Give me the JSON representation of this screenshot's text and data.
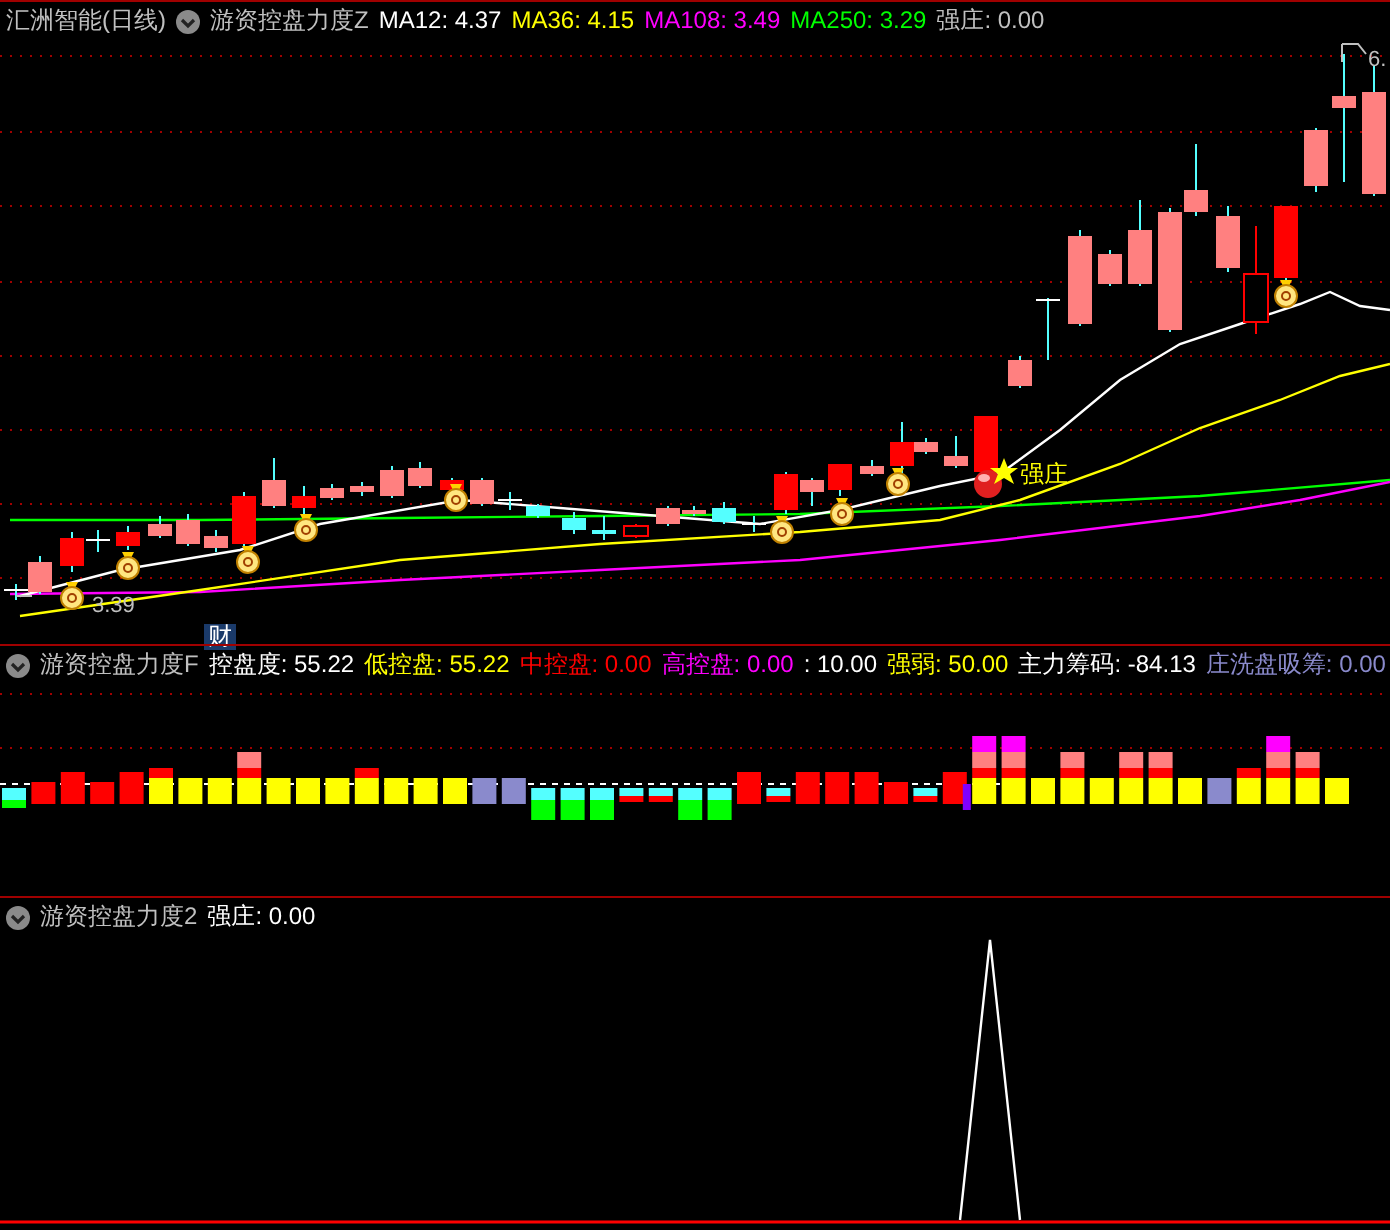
{
  "panels": [
    {
      "title": "汇洲智能(日线)",
      "indicator": "游资控盘力度Z",
      "legend": [
        {
          "text": "MA12: 4.37",
          "color": "#ffffff"
        },
        {
          "text": "MA36: 4.15",
          "color": "#ffff00"
        },
        {
          "text": "MA108: 3.49",
          "color": "#ff00ff"
        },
        {
          "text": "MA250: 3.29",
          "color": "#00ff00"
        },
        {
          "text": "强庄: 0.00",
          "color": "#c0c0c0"
        }
      ],
      "labels": {
        "high_price": "6.",
        "low_price": "3.39",
        "signal": "强庄",
        "badge": "财"
      }
    },
    {
      "indicator": "游资控盘力度F",
      "legend": [
        {
          "text": "控盘度: 55.22",
          "color": "#ffffff"
        },
        {
          "text": "低控盘: 55.22",
          "color": "#ffff00"
        },
        {
          "text": "中控盘: 0.00",
          "color": "#ff0000"
        },
        {
          "text": "高控盘: 0.00",
          "color": "#ff00ff"
        },
        {
          "text": ": 10.00",
          "color": "#ffffff"
        },
        {
          "text": "强弱: 50.00",
          "color": "#ffff00"
        },
        {
          "text": "主力筹码: -84.13",
          "color": "#ffffff"
        },
        {
          "text": "庄洗盘吸筹: 0.00",
          "color": "#8a8acc"
        }
      ]
    },
    {
      "indicator": "游资控盘力度2",
      "legend": [
        {
          "text": "强庄: 0.00",
          "color": "#ffffff"
        }
      ]
    }
  ]
}
